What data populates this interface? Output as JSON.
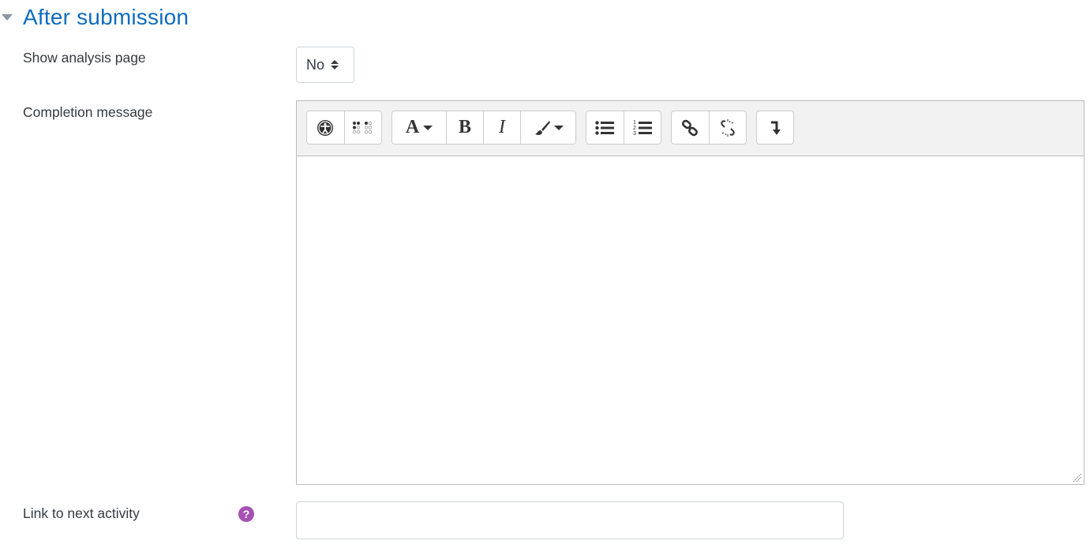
{
  "section": {
    "title": "After submission"
  },
  "fields": {
    "show_analysis": {
      "label": "Show analysis page",
      "value": "No"
    },
    "completion_message": {
      "label": "Completion message",
      "toolbar": [
        {
          "group": "accessibility",
          "buttons": [
            "accessibility-checker",
            "screenreader-helper"
          ]
        },
        {
          "group": "style",
          "buttons": [
            "font-style",
            "bold",
            "italic",
            "font-color"
          ]
        },
        {
          "group": "lists",
          "buttons": [
            "unordered-list",
            "ordered-list"
          ]
        },
        {
          "group": "links",
          "buttons": [
            "link",
            "unlink"
          ]
        },
        {
          "group": "other",
          "buttons": [
            "more-buttons"
          ]
        }
      ],
      "bold_label": "B",
      "italic_label": "I",
      "font_label": "A",
      "value": ""
    },
    "next_activity": {
      "label": "Link to next activity",
      "help": "?",
      "value": ""
    }
  }
}
